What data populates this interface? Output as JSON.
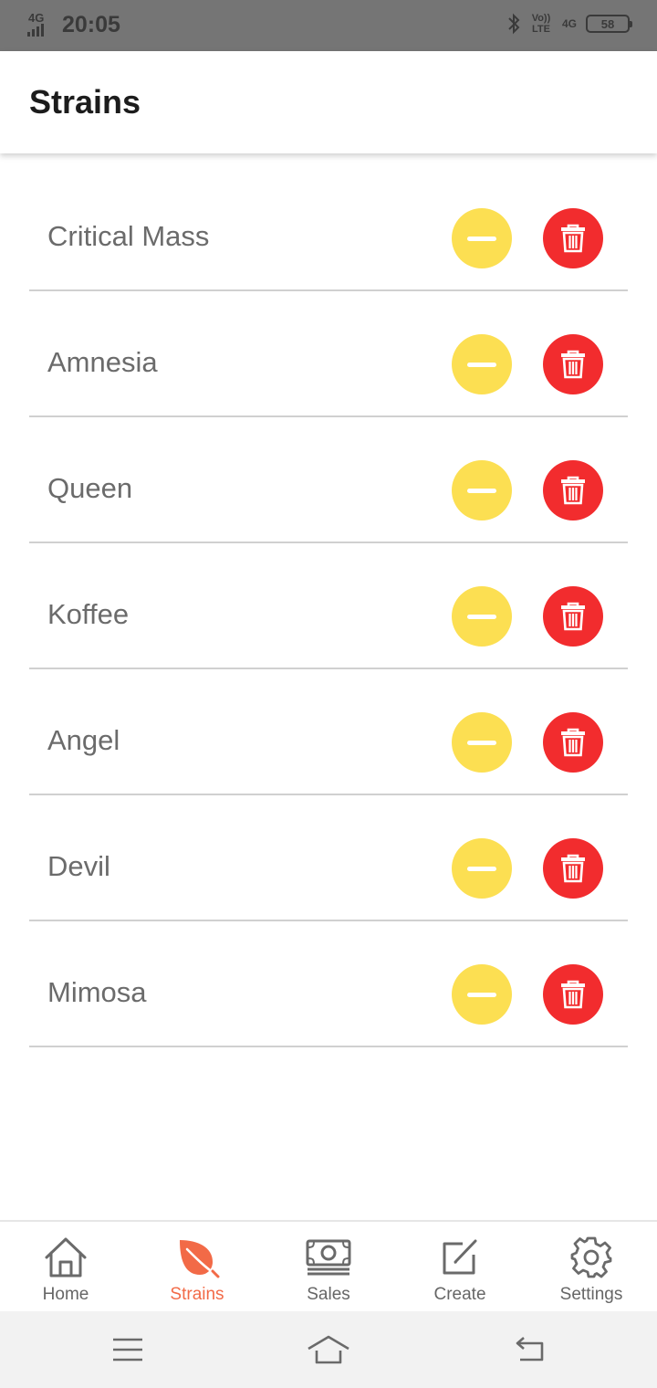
{
  "status_bar": {
    "network_left": "4G",
    "time": "20:05",
    "volte": "Vo)) LTE",
    "network_right": "4G",
    "battery": "58"
  },
  "app_bar": {
    "title": "Strains"
  },
  "strains": [
    {
      "name": "Critical Mass"
    },
    {
      "name": "Amnesia"
    },
    {
      "name": "Queen"
    },
    {
      "name": "Koffee"
    },
    {
      "name": "Angel"
    },
    {
      "name": "Devil"
    },
    {
      "name": "Mimosa"
    }
  ],
  "colors": {
    "accent": "#f26a47",
    "minus_button": "#fcdf52",
    "delete_button": "#f22c2e",
    "divider": "#d0d0d0",
    "status_bar": "#757575"
  },
  "bottom_nav": {
    "active": "strains",
    "items": [
      {
        "label": "Home",
        "icon": "home-icon"
      },
      {
        "label": "Strains",
        "icon": "leaf-icon"
      },
      {
        "label": "Sales",
        "icon": "money-icon"
      },
      {
        "label": "Create",
        "icon": "edit-icon"
      },
      {
        "label": "Settings",
        "icon": "gear-icon"
      }
    ]
  },
  "system_nav": {
    "buttons": [
      "menu-icon",
      "home-outline-icon",
      "back-icon"
    ]
  }
}
